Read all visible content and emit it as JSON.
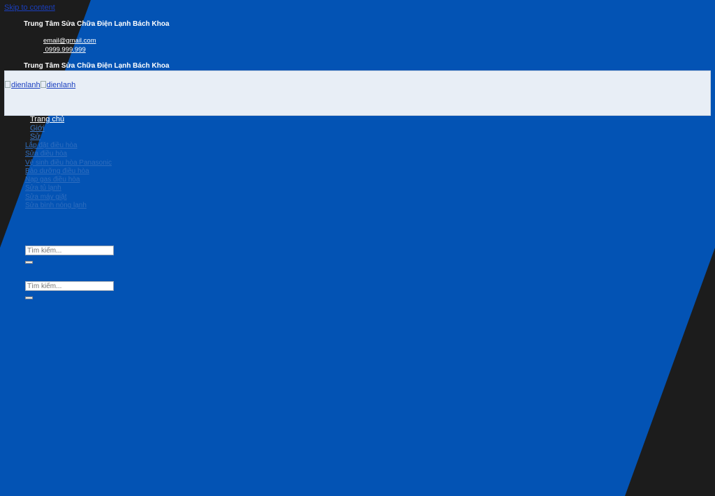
{
  "skip_link": "Skip to content",
  "topbar": {
    "brand": "Trung Tâm Sửa Chữa Điện Lạnh Bách Khoa",
    "email": "email@gmail.com",
    "phone": " 0999.999.999"
  },
  "header": {
    "brand": "Trung Tâm Sửa Chữa Điện Lạnh Bách Khoa",
    "logo_alt_1": "dienlanh",
    "logo_alt_2": "dienlanh"
  },
  "nav": {
    "items": [
      "Trang chủ",
      "Giới",
      "Sử"
    ]
  },
  "sub_links": [
    "Lắp đặt điều hòa",
    "Sửa điều hòa",
    "Vệ sinh điều hòa Panasonic",
    "Bảo dưỡng điều hòa",
    "Nạp gas điều hòa",
    "Sửa tủ lạnh",
    "Sửa máy giặt",
    "Sửa bình nóng lạnh"
  ],
  "search": {
    "placeholder_1": "Tìm kiếm...",
    "placeholder_2": "Tìm kiếm..."
  },
  "colors": {
    "background_blue": "#0353b4",
    "background_dark": "#1c1c1c",
    "header_band": "#e8eef6"
  }
}
